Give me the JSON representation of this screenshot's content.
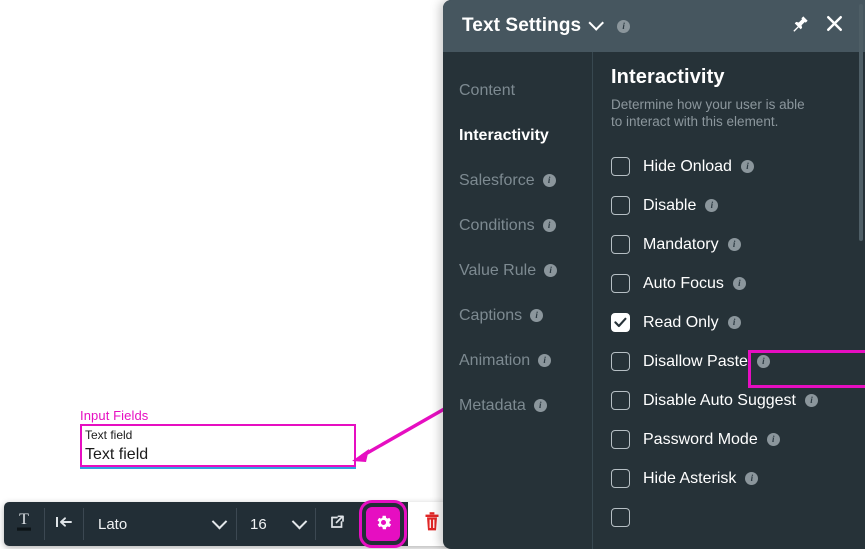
{
  "canvas": {
    "input_fields": {
      "label": "Input Fields",
      "caption": "Text field",
      "value": "Text field"
    }
  },
  "toolbar": {
    "text_tool_icon": "text-format-icon",
    "align_tool_icon": "align-left-icon",
    "font_family": "Lato",
    "font_size": "16",
    "open_tool_icon": "external-link-icon",
    "settings_icon": "gear-icon",
    "delete_icon": "trash-icon",
    "accent_color": "#e60ec1"
  },
  "panel": {
    "title": "Text Settings",
    "title_chevron_icon": "chevron-down-icon",
    "title_info_icon": "info-icon",
    "pin_icon": "pin-icon",
    "close_icon": "close-icon",
    "header_bg": "#46565f",
    "body_bg": "#263238",
    "nav": [
      {
        "label": "Content",
        "active": false,
        "info": false
      },
      {
        "label": "Interactivity",
        "active": true,
        "info": false
      },
      {
        "label": "Salesforce",
        "active": false,
        "info": true
      },
      {
        "label": "Conditions",
        "active": false,
        "info": true
      },
      {
        "label": "Value Rule",
        "active": false,
        "info": true
      },
      {
        "label": "Captions",
        "active": false,
        "info": true
      },
      {
        "label": "Animation",
        "active": false,
        "info": true
      },
      {
        "label": "Metadata",
        "active": false,
        "info": true
      }
    ],
    "content": {
      "heading": "Interactivity",
      "subtitle": "Determine how your user is able to interact with this element.",
      "options": [
        {
          "label": "Hide Onload",
          "checked": false,
          "info": true
        },
        {
          "label": "Disable",
          "checked": false,
          "info": true
        },
        {
          "label": "Mandatory",
          "checked": false,
          "info": true
        },
        {
          "label": "Auto Focus",
          "checked": false,
          "info": true
        },
        {
          "label": "Read Only",
          "checked": true,
          "info": true,
          "highlighted": true
        },
        {
          "label": "Disallow Paste",
          "checked": false,
          "info": true
        },
        {
          "label": "Disable Auto Suggest",
          "checked": false,
          "info": true
        },
        {
          "label": "Password Mode",
          "checked": false,
          "info": true
        },
        {
          "label": "Hide Asterisk",
          "checked": false,
          "info": true
        }
      ]
    }
  },
  "annotation": {
    "color": "#e60ec1",
    "from": "read-only-option",
    "to": "input-fields-widget"
  }
}
